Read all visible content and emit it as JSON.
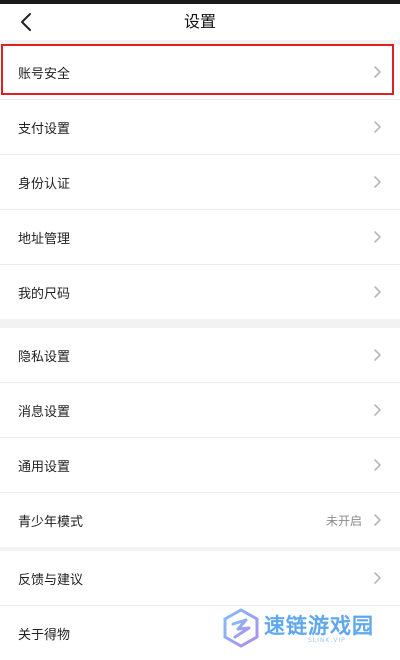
{
  "header": {
    "title": "设置"
  },
  "settings_groups": [
    {
      "items": [
        {
          "label": "账号安全",
          "chevron": "chevron-right-icon",
          "highlighted": true
        },
        {
          "label": "支付设置",
          "chevron": "chevron-right-icon"
        },
        {
          "label": "身份认证",
          "chevron": "chevron-right-icon"
        },
        {
          "label": "地址管理",
          "chevron": "chevron-right-icon"
        },
        {
          "label": "我的尺码",
          "chevron": "chevron-right-icon"
        }
      ]
    },
    {
      "items": [
        {
          "label": "隐私设置",
          "chevron": "chevron-right-icon"
        },
        {
          "label": "消息设置",
          "chevron": "chevron-right-icon"
        },
        {
          "label": "通用设置",
          "chevron": "chevron-right-icon"
        },
        {
          "label": "青少年模式",
          "value": "未开启",
          "chevron": "chevron-right-icon"
        }
      ]
    },
    {
      "items": [
        {
          "label": "反馈与建议",
          "chevron": "chevron-right-icon"
        },
        {
          "label": "关于得物"
        }
      ]
    }
  ],
  "watermark": {
    "text": "速链游戏园",
    "subtext": "SLINK.VIP"
  },
  "colors": {
    "highlight_border": "#e02020",
    "background": "#f2f2f2",
    "row_background": "#ffffff",
    "watermark": "#5fa8ee"
  }
}
